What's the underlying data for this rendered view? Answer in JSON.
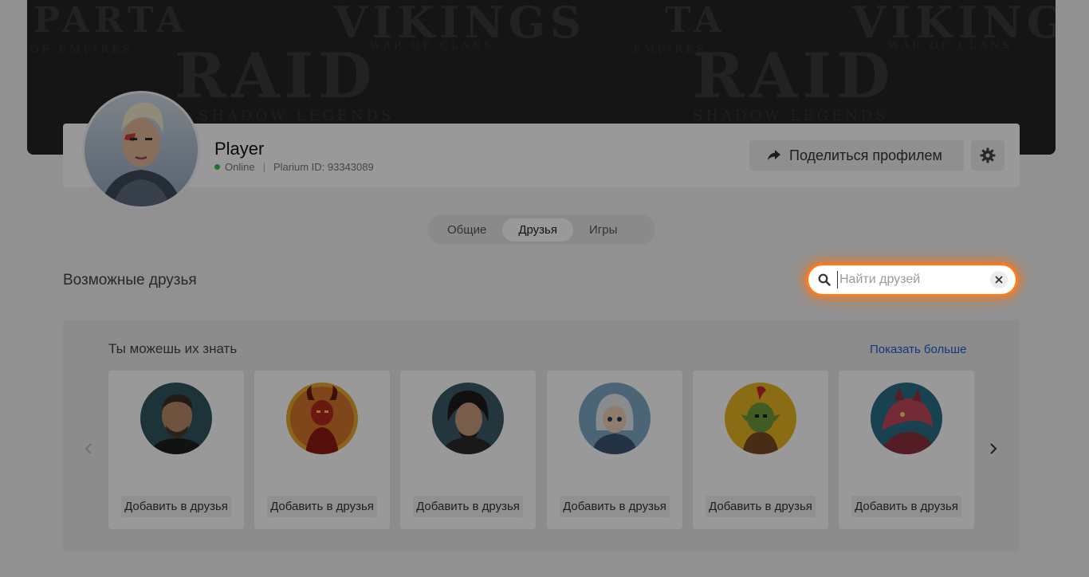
{
  "banner": {
    "watermarks": [
      "PARTA",
      "VIKINGS",
      "TA",
      "VIKINGS",
      "RAID",
      "RAID",
      "SHADOW LEGENDS",
      "SHADOW LEGENDS",
      "WAR OF CLANS",
      "WAR OF CLANS",
      "OF EMPIRES",
      "EMPIRES"
    ]
  },
  "profile": {
    "name": "Player",
    "status": "Online",
    "plarium_id": "Plarium ID: 93343089",
    "share_label": "Поделиться профилем"
  },
  "tabs": [
    {
      "label": "Общие",
      "active": false
    },
    {
      "label": "Друзья",
      "active": true
    },
    {
      "label": "Игры",
      "active": false
    }
  ],
  "section_title": "Возможные друзья",
  "search": {
    "placeholder": "Найти друзей",
    "value": ""
  },
  "suggestions": {
    "title": "Ты можешь их знать",
    "show_more": "Показать больше",
    "cards": [
      {
        "add_label": "Добавить в друзья",
        "avatar_color": "#2f5560"
      },
      {
        "add_label": "Добавить в друзья",
        "avatar_color": "#c7531c"
      },
      {
        "add_label": "Добавить в друзья",
        "avatar_color": "#3c5a66"
      },
      {
        "add_label": "Добавить в друзья",
        "avatar_color": "#7ea9c6"
      },
      {
        "add_label": "Добавить в друзья",
        "avatar_color": "#e6b422"
      },
      {
        "add_label": "Добавить в друзья",
        "avatar_color": "#2a6f86"
      }
    ]
  },
  "colors": {
    "accent_link": "#1a5fd0",
    "focus_glow": "#ff7a1a",
    "online": "#35c24b"
  }
}
